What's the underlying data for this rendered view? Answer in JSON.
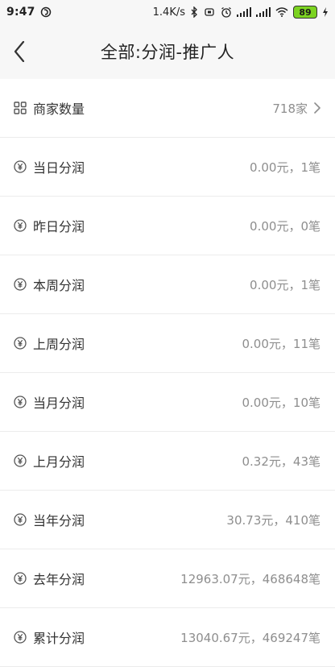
{
  "status_bar": {
    "time": "9:47",
    "net_speed": "1.4K/s",
    "battery": "89"
  },
  "header": {
    "title": "全部:分润-推广人"
  },
  "rows": [
    {
      "label": "商家数量",
      "value": "718家",
      "icon": "grid-icon",
      "has_chevron": true
    },
    {
      "label": "当日分润",
      "value": "0.00元，1笔",
      "icon": "yen-icon"
    },
    {
      "label": "昨日分润",
      "value": "0.00元，0笔",
      "icon": "yen-icon"
    },
    {
      "label": "本周分润",
      "value": "0.00元，1笔",
      "icon": "yen-icon"
    },
    {
      "label": "上周分润",
      "value": "0.00元，11笔",
      "icon": "yen-icon"
    },
    {
      "label": "当月分润",
      "value": "0.00元，10笔",
      "icon": "yen-icon"
    },
    {
      "label": "上月分润",
      "value": "0.32元，43笔",
      "icon": "yen-icon"
    },
    {
      "label": "当年分润",
      "value": "30.73元，410笔",
      "icon": "yen-icon"
    },
    {
      "label": "去年分润",
      "value": "12963.07元，468648笔",
      "icon": "yen-icon"
    },
    {
      "label": "累计分润",
      "value": "13040.67元，469247笔",
      "icon": "yen-icon"
    }
  ]
}
